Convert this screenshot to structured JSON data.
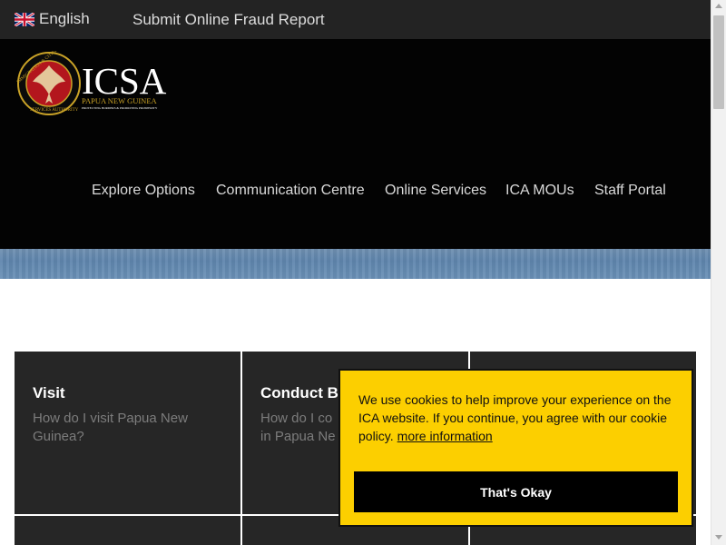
{
  "topbar": {
    "language": "English",
    "fraud_report": "Submit Online Fraud Report"
  },
  "logo": {
    "acronym": "ICSA",
    "country": "PAPUA NEW GUINEA",
    "tagline": "PROTECTING BORDERS & PROMOTING PROSPERITY",
    "seal_text_top": "IMMIGRATION & CITIZENSHIP",
    "seal_text_bottom": "SERVICES AUTHORITY"
  },
  "nav": {
    "items": [
      {
        "label": "Explore Options"
      },
      {
        "label": "Communication Centre"
      },
      {
        "label": "Online Services"
      },
      {
        "label": "ICA MOUs"
      },
      {
        "label": "Staff Portal"
      }
    ]
  },
  "tiles": [
    {
      "title": "Visit",
      "desc": "How do I visit Papua New Guinea?"
    },
    {
      "title": "Conduct B",
      "desc": "How do I co in Papua Ne"
    }
  ],
  "cookie": {
    "message": "We use cookies to help improve your experience on the ICA website. If you continue, you agree with our cookie policy.",
    "link": "more information",
    "button": "That's Okay"
  },
  "colors": {
    "accent_yellow": "#fccf00",
    "header_bg": "#030303",
    "tile_bg": "#262626",
    "logo_gold": "#c9a227",
    "logo_red": "#b3161d"
  }
}
